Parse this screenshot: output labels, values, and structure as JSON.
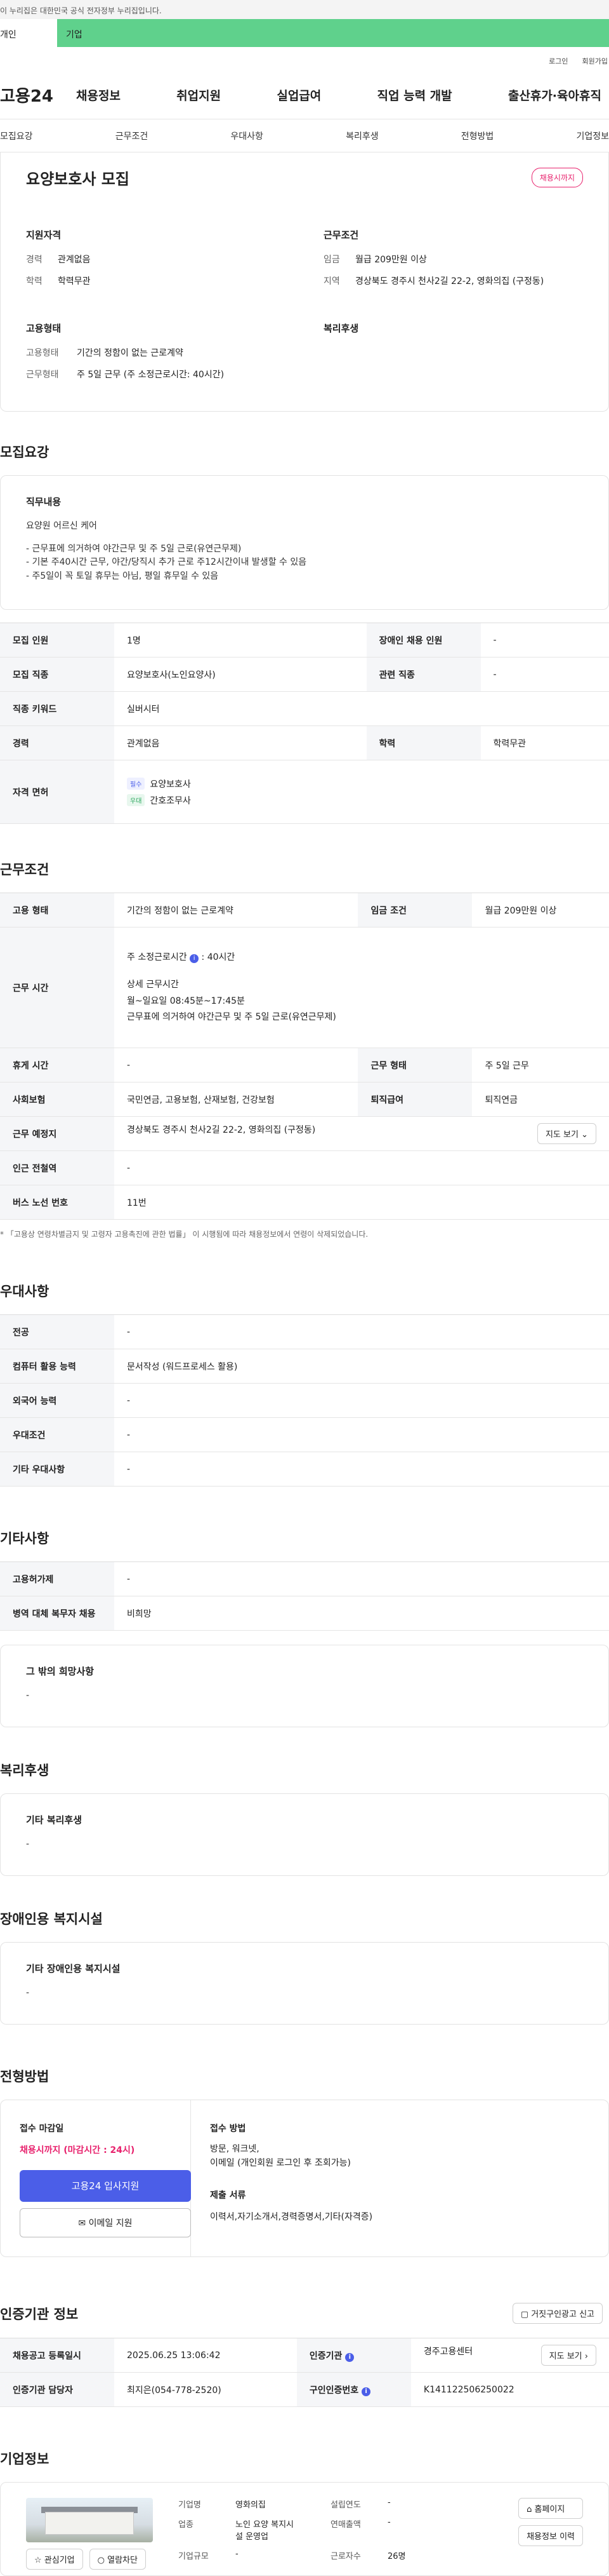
{
  "notice": "이 누리집은 대한민국 공식 전자정부 누리집입니다.",
  "tabs": {
    "person": "개인",
    "corp": "기업"
  },
  "util": {
    "login": "로그인",
    "join": "회원가입"
  },
  "gnb": {
    "logo": "고용24",
    "menu": [
      "채용정보",
      "취업지원",
      "실업급여",
      "직업 능력 개발",
      "출산휴가·육아휴직"
    ]
  },
  "subnav": [
    "모집요강",
    "근무조건",
    "우대사항",
    "복리후생",
    "전형방법",
    "기업정보"
  ],
  "summary": {
    "title": "요양보호사 모집",
    "badge": "채용시까지",
    "qual_title": "지원자격",
    "qual": [
      {
        "k": "경력",
        "v": "관계없음"
      },
      {
        "k": "학력",
        "v": "학력무관"
      }
    ],
    "cond_title": "근무조건",
    "cond": [
      {
        "k": "임금",
        "v": "월급 209만원 이상"
      },
      {
        "k": "지역",
        "v": "경상북도 경주시 천사2길 22-2, 영화의집 (구정동)"
      }
    ],
    "emp_title": "고용형태",
    "emp": [
      {
        "k": "고용형태",
        "v": "기간의 정함이 없는 근로계약"
      },
      {
        "k": "근무형태",
        "v": "주 5일 근무 (주 소정근로시간: 40시간)"
      }
    ],
    "welfare_title": "복리후생"
  },
  "recruit": {
    "title": "모집요강",
    "duty_title": "직무내용",
    "duty_lines": [
      "요양원 어르신 케어",
      "",
      "- 근무표에 의거하여 야간근무 및 주 5일 근로(유연근무제)",
      "- 기본 주40시간 근무, 야간/당직시 추가 근로 주12시간이내 발생할 수 있음",
      "- 주5일이 꼭 토일 휴무는 아님, 평일 휴무일 수 있음"
    ],
    "rows": [
      {
        "k1": "모집 인원",
        "v1": "1명",
        "k2": "장애인 채용 인원",
        "v2": "-"
      },
      {
        "k1": "모집 직종",
        "v1": "요양보호사(노인요양사)",
        "k2": "관련 직종",
        "v2": "-"
      },
      {
        "k1": "직종 키워드",
        "v1": "실버시터"
      },
      {
        "k1": "경력",
        "v1": "관계없음",
        "k2": "학력",
        "v2": "학력무관"
      }
    ],
    "license_label": "자격 면허",
    "licenses": [
      {
        "tag": "필수",
        "name": "요양보호사"
      },
      {
        "tag": "우대",
        "name": "간호조무사"
      }
    ]
  },
  "work": {
    "title": "근무조건",
    "emp_k": "고용 형태",
    "emp_v": "기간의 정함이 없는 근로계약",
    "pay_k": "임금 조건",
    "pay_v": "월급 209만원 이상",
    "time_k": "근무 시간",
    "time_week": "주 소정근로시간",
    "time_hours": ": 40시간",
    "time_detail_title": "상세 근무시간",
    "time_detail": [
      "월~일요일 08:45분~17:45분",
      "근무표에 의거하여 야간근무 및 주 5일 근로(유연근무제)"
    ],
    "rest_k": "휴게 시간",
    "rest_v": "-",
    "shape_k": "근무 형태",
    "shape_v": "주 5일 근무",
    "ins_k": "사회보험",
    "ins_v": "국민연금, 고용보험, 산재보험, 건강보험",
    "ret_k": "퇴직급여",
    "ret_v": "퇴직연금",
    "place_k": "근무 예정지",
    "place_v": "경상북도 경주시 천사2길 22-2, 영화의집 (구정동)",
    "map_btn": "지도 보기",
    "station_k": "인근 전철역",
    "station_v": "-",
    "bus_k": "버스 노선 번호",
    "bus_v": "11번",
    "note": "* 「고용상 연령차별금지 및 고령자 고용촉진에 관한 법률」 이 시행됨에 따라 채용정보에서 연령이 삭제되었습니다."
  },
  "prefer": {
    "title": "우대사항",
    "rows": [
      {
        "k": "전공",
        "v": "-"
      },
      {
        "k": "컴퓨터 활용 능력",
        "v": "문서작성 (워드프로세스 활용)"
      },
      {
        "k": "외국어 능력",
        "v": "-"
      },
      {
        "k": "우대조건",
        "v": "-"
      },
      {
        "k": "기타 우대사항",
        "v": "-"
      }
    ]
  },
  "etc": {
    "title": "기타사항",
    "rows": [
      {
        "k": "고용허가제",
        "v": "-"
      },
      {
        "k": "병역 대체 복무자 채용",
        "v": "비희망"
      }
    ],
    "hope_title": "그 밖의 희망사항",
    "hope_v": "-"
  },
  "welfare": {
    "title": "복리후생",
    "box_title": "기타 복리후생",
    "box_v": "-"
  },
  "disabled": {
    "title": "장애인용 복지시설",
    "box_title": "기타 장애인용 복지시설",
    "box_v": "-"
  },
  "process": {
    "title": "전형방법",
    "deadline_title": "접수 마감일",
    "deadline_v": "채용시까지 (마감시간 : 24시)",
    "apply_btn": "고용24 입사지원",
    "mail_btn": "이메일 지원",
    "method_title": "접수 방법",
    "method_lines": [
      "방문, 워크넷,",
      "이메일 (개인회원 로그인 후 조회가능)"
    ],
    "docs_title": "제출 서류",
    "docs_v": "이력서,자기소개서,경력증명서,기타(자격증)"
  },
  "agency": {
    "title": "인증기관 정보",
    "report_btn": "거짓구인광고 신고",
    "reg_k": "채용공고 등록일시",
    "reg_v": "2025.06.25 13:06:42",
    "auth_k": "인증기관",
    "auth_v": "경주고용센터",
    "map_btn": "지도 보기",
    "mgr_k": "인증기관 담당자",
    "mgr_v": "최지은(054-778-2520)",
    "num_k": "구인인증번호",
    "num_v": "K141122506250022"
  },
  "company": {
    "title": "기업정보",
    "name_k": "기업명",
    "name_v": "영화의집",
    "ind_k": "업종",
    "ind_v1": "노인 요양 복지시",
    "ind_v2": "설 운영업",
    "size_k": "기업규모",
    "size_v": "-",
    "year_k": "설립연도",
    "year_v": "-",
    "sales_k": "연매출액",
    "sales_v": "-",
    "emp_k": "근로자수",
    "emp_v": "26명",
    "fav_btn": "관심기업",
    "block_btn": "열람차단",
    "home_btn": "홈페이지",
    "history_btn": "채용정보 이력"
  }
}
